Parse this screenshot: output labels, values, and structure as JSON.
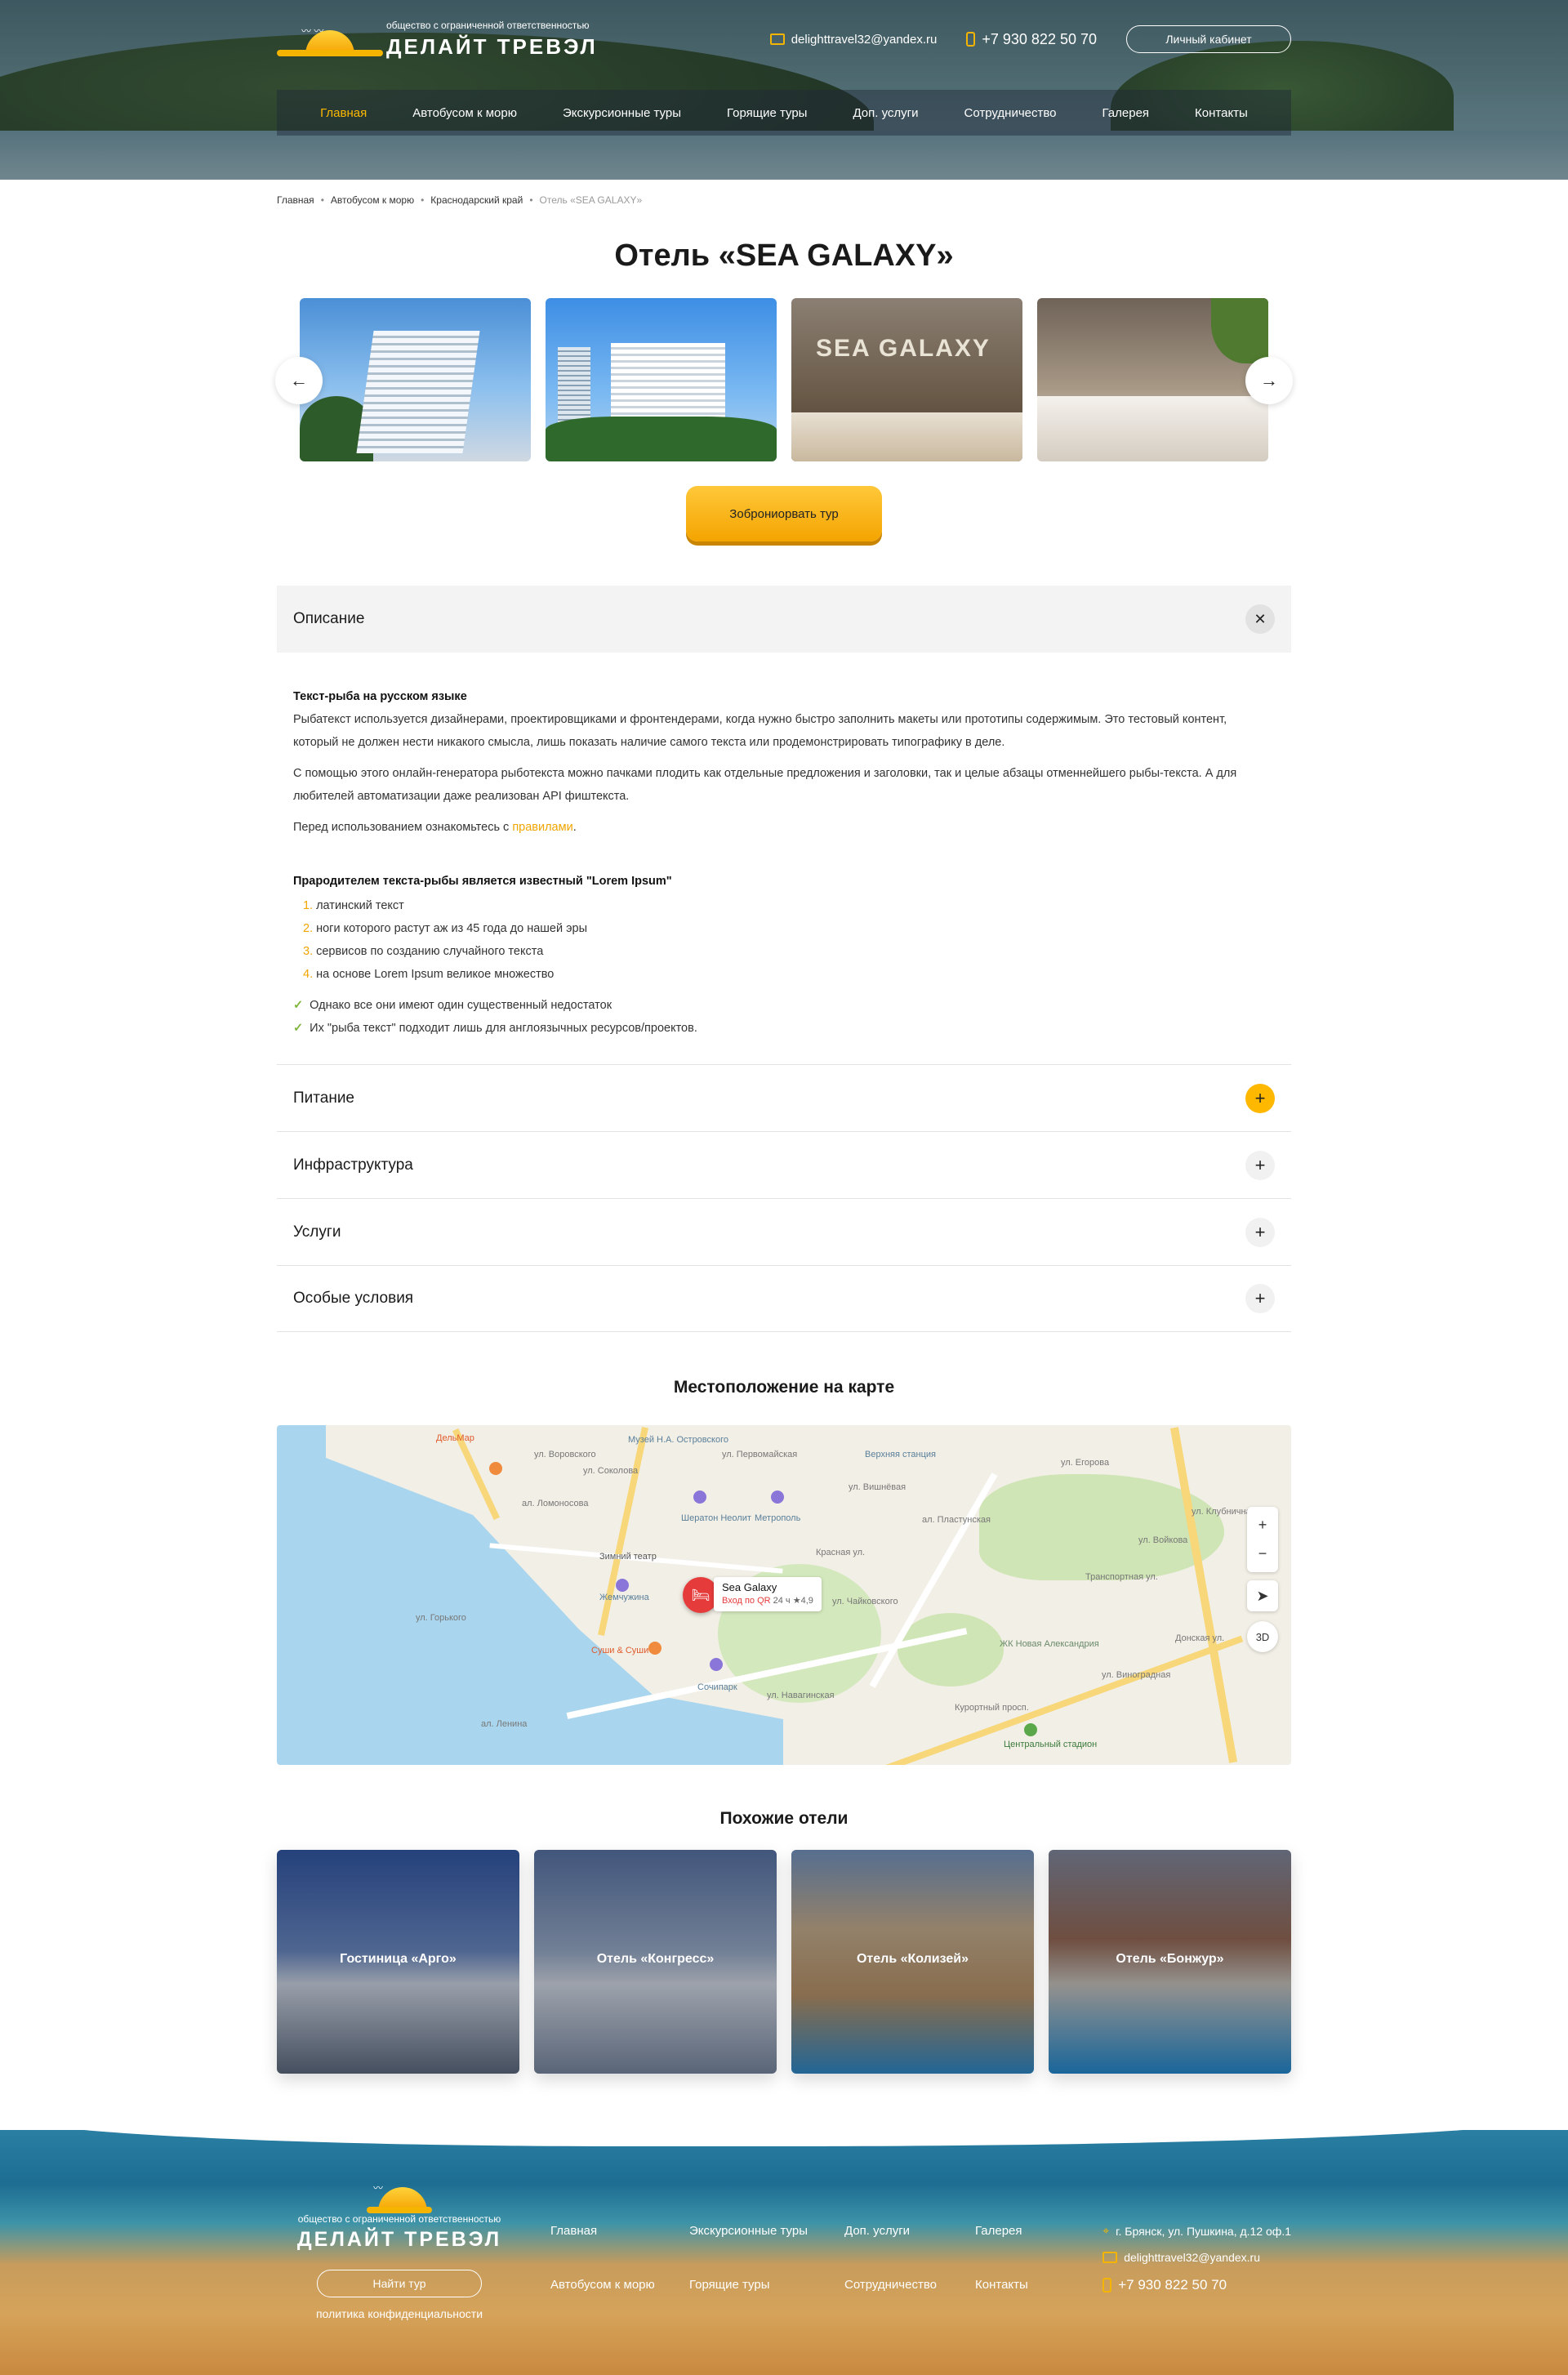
{
  "header": {
    "logo_small": "общество с ограниченной ответственностью",
    "logo_big": "ДЕЛАЙТ ТРЕВЭЛ",
    "email": "delighttravel32@yandex.ru",
    "phone": "+7 930 822 50 70",
    "cabinet": "Личный кабинет"
  },
  "nav": [
    {
      "label": "Главная",
      "active": true
    },
    {
      "label": "Автобусом к морю"
    },
    {
      "label": "Экскурсионные туры"
    },
    {
      "label": "Горящие туры"
    },
    {
      "label": "Доп. услуги"
    },
    {
      "label": "Сотрудничество"
    },
    {
      "label": "Галерея"
    },
    {
      "label": "Контакты"
    }
  ],
  "breadcrumb": [
    "Главная",
    "Автобусом к морю",
    "Краснодарский край",
    "Отель «SEA GALAXY»"
  ],
  "title": "Отель «SEA GALAXY»",
  "gallery": {
    "slide3_sign": "SEA GALAXY"
  },
  "book_button": "Зоброниорвать тур",
  "accordion": {
    "description": {
      "title": "Описание",
      "sub1": "Текст-рыба на русском языке",
      "p1": "Рыбатекст используется дизайнерами, проектировщиками и фронтендерами, когда нужно быстро заполнить макеты или прототипы содержимым. Это тестовый контент, который не должен нести никакого смысла, лишь показать наличие самого текста или продемонстрировать типографику в деле.",
      "p2": "С помощью этого онлайн-генератора рыботекста можно пачками плодить как отдельные предложения и заголовки, так и целые абзацы отменнейшего рыбы-текста. А для любителей автоматизации даже реализован API фиштекста.",
      "p3_before": "Перед использованием ознакомьтесь с ",
      "p3_link": "правилами",
      "p3_after": ".",
      "sub2": "Прародителем текста-рыбы является известный \"Lorem Ipsum\"",
      "ol": [
        "латинский текст",
        "ноги которого растут аж из 45 года до нашей эры",
        "сервисов по созданию случайного текста",
        "на основе Lorem Ipsum великое множество"
      ],
      "ul": [
        "Однако все они имеют один существенный недостаток",
        "Их \"рыба текст\" подходит лишь для англоязычных ресурсов/проектов."
      ]
    },
    "food": "Питание",
    "infra": "Инфраструктура",
    "services": "Услуги",
    "special": "Особые условия"
  },
  "map": {
    "title": "Местоположение на карте",
    "pin_name": "Sea Galaxy",
    "pin_sub_red": "Вход по QR",
    "pin_sub": " 24 ч  ★4,9",
    "labels": [
      "Музей Н.А. Островского",
      "Верхняя станция",
      "Шератон Неолит",
      "Метрополь",
      "Зимний театр",
      "Жемчужина",
      "Суши & Суши",
      "Сочипарк",
      "ул. Навагинская",
      "ул. Первомайская",
      "Курортный просп.",
      "ЖК Новая Александрия",
      "Центральный стадион",
      "ДельМар",
      "ул. Воровского",
      "ул. Соколова",
      "ал. Пластунская",
      "ул. Чайковского",
      "Транспортная ул.",
      "ул. Войкова",
      "ул. Клубничная",
      "Донская ул.",
      "Красная ул.",
      "ул. Вишнёвая",
      "ал. Ломоносова",
      "ул. Егорова",
      "ул. Виноградная",
      "ул. Горького",
      "ал. Ленина"
    ],
    "ctrl_3d": "3D"
  },
  "similar": {
    "title": "Похожие отели",
    "cards": [
      "Гостиница «Арго»",
      "Отель «Конгресс»",
      "Отель «Колизей»",
      "Отель «Бонжур»"
    ]
  },
  "footer": {
    "logo_small": "общество с ограниченной ответственностью",
    "logo_big": "ДЕЛАЙТ ТРЕВЭЛ",
    "find_button": "Найти тур",
    "privacy": "политика конфиденциальности",
    "menu": [
      "Главная",
      "Экскурсионные туры",
      "Доп. услуги",
      "Галерея",
      "Автобусом к морю",
      "Горящие туры",
      "Сотрудничество",
      "Контакты"
    ],
    "address": "г. Брянск, ул. Пушкина, д.12 оф.1",
    "email": "delighttravel32@yandex.ru",
    "phone": "+7 930 822 50 70"
  }
}
